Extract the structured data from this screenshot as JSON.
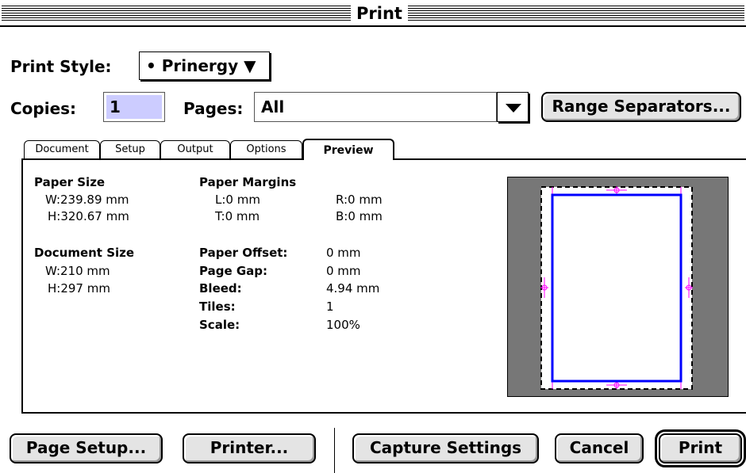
{
  "window": {
    "title": "Print"
  },
  "print_style": {
    "label": "Print Style:",
    "value": "• Prinergy ▼"
  },
  "copies": {
    "label": "Copies:",
    "value": "1"
  },
  "pages": {
    "label": "Pages:",
    "value": "All"
  },
  "range_separators": {
    "label": "Range Separators..."
  },
  "tabs": [
    {
      "label": "Document"
    },
    {
      "label": "Setup"
    },
    {
      "label": "Output"
    },
    {
      "label": "Options"
    },
    {
      "label": "Preview"
    }
  ],
  "active_tab": "Preview",
  "preview": {
    "paper_size": {
      "heading": "Paper Size",
      "w": "W:239.89 mm",
      "h": "H:320.67 mm"
    },
    "document_size": {
      "heading": "Document Size",
      "w": "W:210 mm",
      "h": "H:297 mm"
    },
    "paper_margins": {
      "heading": "Paper Margins",
      "l": "L:0 mm",
      "r": "R:0 mm",
      "t": "T:0 mm",
      "b": "B:0 mm"
    },
    "paper_offset": {
      "label": "Paper Offset:",
      "value": "0 mm"
    },
    "page_gap": {
      "label": "Page Gap:",
      "value": "0 mm"
    },
    "bleed": {
      "label": "Bleed:",
      "value": "4.94 mm"
    },
    "tiles": {
      "label": "Tiles:",
      "value": "1"
    },
    "scale": {
      "label": "Scale:",
      "value": "100%"
    },
    "colors": {
      "page_border": "#0000ff",
      "marks": "#ff00ff",
      "pasteboard": "#777777"
    }
  },
  "buttons": {
    "page_setup": "Page Setup...",
    "printer": "Printer...",
    "capture_settings": "Capture Settings",
    "cancel": "Cancel",
    "print": "Print"
  }
}
